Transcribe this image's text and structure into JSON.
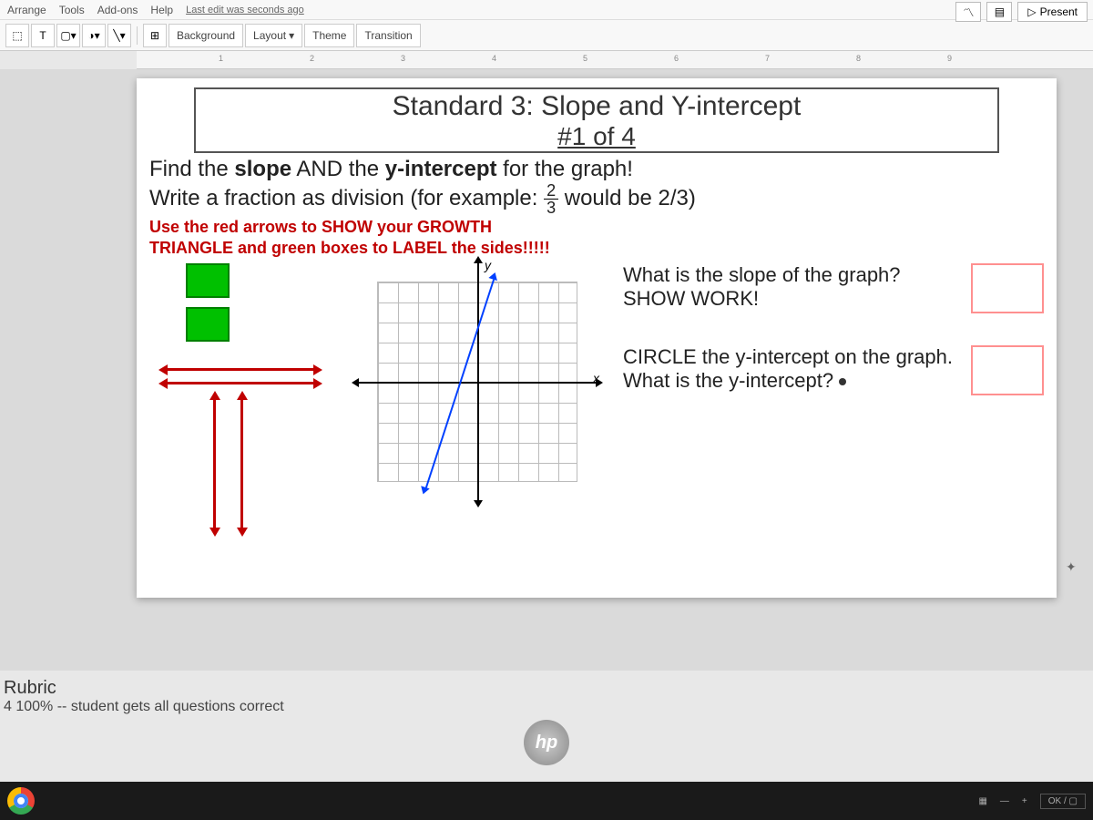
{
  "menu": {
    "items": [
      "Arrange",
      "Tools",
      "Add-ons",
      "Help"
    ],
    "lastedit": "Last edit was seconds ago"
  },
  "topright": {
    "present": "Present"
  },
  "toolbar": {
    "background": "Background",
    "layout": "Layout",
    "theme": "Theme",
    "transition": "Transition"
  },
  "ruler": {
    "marks": [
      "1",
      "2",
      "3",
      "4",
      "5",
      "6",
      "7",
      "8",
      "9"
    ]
  },
  "slide": {
    "title1": "Standard 3: Slope and Y-intercept",
    "title2": "#1 of 4",
    "instr1a": "Find the ",
    "instr1b": "slope",
    "instr1c": " AND the ",
    "instr1d": "y-intercept",
    "instr1e": " for the graph!",
    "instr2a": "Write a fraction as division (for example: ",
    "instr2b": " would be 2/3)",
    "frac_n": "2",
    "frac_d": "3",
    "redline1": "Use the red arrows to SHOW your GROWTH",
    "redline2": "TRIANGLE and green boxes to LABEL the sides!!!!!",
    "axis_x": "x",
    "axis_y": "y",
    "q1": "What is the slope of the graph? SHOW WORK!",
    "q2": "CIRCLE the y-intercept on the graph.  What is the y-intercept?"
  },
  "notes": {
    "title": "Rubric",
    "line1": "4  100% -- student gets all questions correct"
  },
  "hp": "hp",
  "tray": {
    "ok": "OK / ▢"
  }
}
